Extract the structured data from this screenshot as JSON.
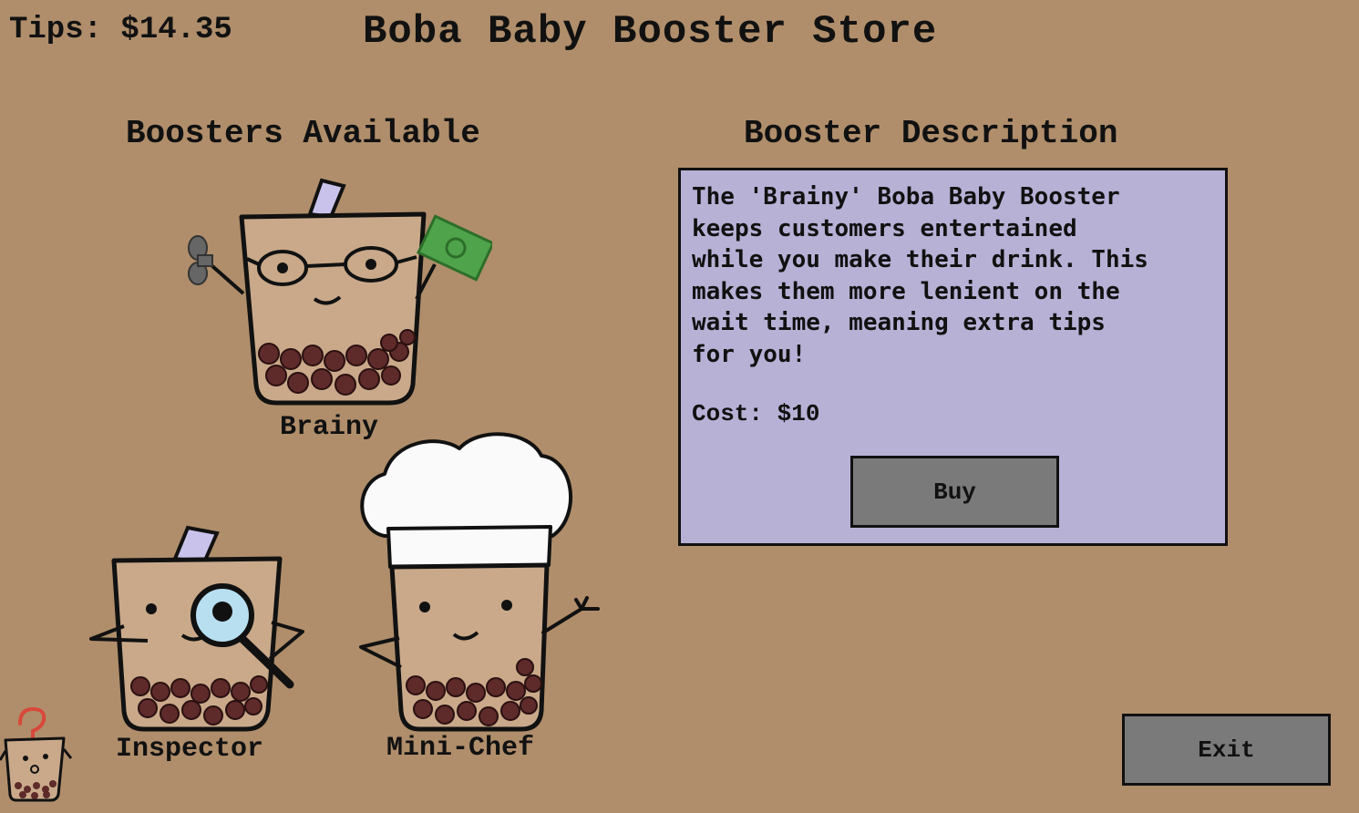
{
  "header": {
    "tips_text": "Tips: $14.35",
    "title": "Boba Baby Booster Store"
  },
  "boosters_panel": {
    "heading": "Boosters Available",
    "items": [
      {
        "label": "Brainy"
      },
      {
        "label": "Inspector"
      },
      {
        "label": "Mini-Chef"
      }
    ]
  },
  "description_panel": {
    "heading": "Booster Description",
    "text": "The 'Brainy' Boba Baby Booster\nkeeps customers entertained\nwhile you make their drink. This\nmakes them more lenient on the\nwait time, meaning extra tips\nfor you!",
    "cost_text": "Cost: $10",
    "buy_label": "Buy"
  },
  "footer": {
    "exit_label": "Exit"
  },
  "colors": {
    "background": "#b08e6b",
    "panel": "#b8b1d6",
    "button": "#7a7a7a",
    "cup": "#c9a98a",
    "boba": "#5e2a2a",
    "straw": "#c9c3ec"
  }
}
